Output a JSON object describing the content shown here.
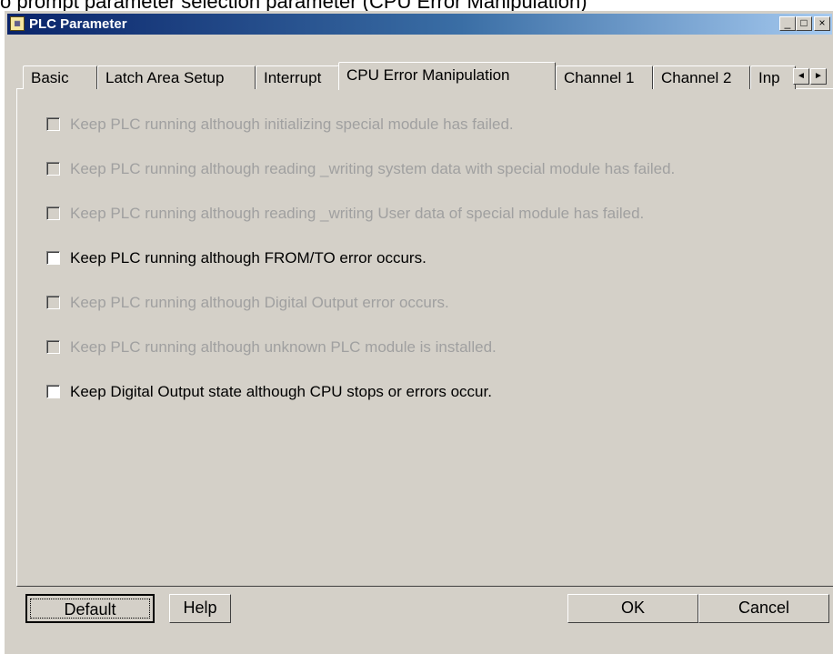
{
  "background_strip": "o prompt parameter selection parameter (CPU Error Manipulation)",
  "window": {
    "title": "PLC Parameter",
    "app_icon": "plc-app-icon",
    "controls": {
      "minimize": "_",
      "maximize": "□",
      "close": "×"
    }
  },
  "tabs": [
    {
      "label": "Basic",
      "active": false
    },
    {
      "label": "Latch Area Setup",
      "active": false
    },
    {
      "label": "Interrupt",
      "active": false
    },
    {
      "label": "CPU Error Manipulation",
      "active": true
    },
    {
      "label": "Channel 1",
      "active": false
    },
    {
      "label": "Channel 2",
      "active": false
    },
    {
      "label": "Inp",
      "active": false
    }
  ],
  "tab_scroll": {
    "left": "◄",
    "right": "►"
  },
  "options": [
    {
      "label": "Keep PLC running although initializing special module has failed.",
      "enabled": false,
      "checked": false
    },
    {
      "label": "Keep PLC running although reading _writing system data with special module has failed.",
      "enabled": false,
      "checked": false
    },
    {
      "label": "Keep PLC running although reading _writing User data of special module has failed.",
      "enabled": false,
      "checked": false
    },
    {
      "label": "Keep PLC running although FROM/TO error occurs.",
      "enabled": true,
      "checked": false
    },
    {
      "label": "Keep PLC running although Digital Output error occurs.",
      "enabled": false,
      "checked": false
    },
    {
      "label": "Keep PLC running although unknown PLC module is installed.",
      "enabled": false,
      "checked": false
    },
    {
      "label": "Keep Digital Output state although CPU stops or errors occur.",
      "enabled": true,
      "checked": false
    }
  ],
  "buttons": {
    "default": "Default",
    "help": "Help",
    "ok": "OK",
    "cancel": "Cancel"
  }
}
